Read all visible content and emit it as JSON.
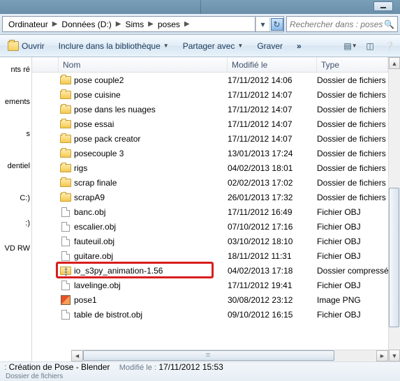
{
  "breadcrumb": {
    "items": [
      "Ordinateur",
      "Données (D:)",
      "Sims",
      "poses"
    ]
  },
  "search": {
    "placeholder": "Rechercher dans : poses"
  },
  "toolbar": {
    "open_label": "Ouvrir",
    "include_label": "Inclure dans la bibliothèque",
    "share_label": "Partager avec",
    "burn_label": "Graver"
  },
  "sidebar": {
    "items": [
      "nts ré",
      "ements",
      "s",
      "dentiel",
      "C:)",
      ":)",
      "VD RW"
    ]
  },
  "columns": {
    "name": "Nom",
    "modified": "Modifié le",
    "type": "Type"
  },
  "files": [
    {
      "icon": "folder",
      "name": "pose couple2",
      "modified": "17/11/2012 14:06",
      "type": "Dossier de fichiers"
    },
    {
      "icon": "folder",
      "name": "pose cuisine",
      "modified": "17/11/2012 14:07",
      "type": "Dossier de fichiers"
    },
    {
      "icon": "folder",
      "name": "pose dans les nuages",
      "modified": "17/11/2012 14:07",
      "type": "Dossier de fichiers"
    },
    {
      "icon": "folder",
      "name": "pose essai",
      "modified": "17/11/2012 14:07",
      "type": "Dossier de fichiers"
    },
    {
      "icon": "folder",
      "name": "pose pack creator",
      "modified": "17/11/2012 14:07",
      "type": "Dossier de fichiers"
    },
    {
      "icon": "folder",
      "name": "posecouple 3",
      "modified": "13/01/2013 17:24",
      "type": "Dossier de fichiers"
    },
    {
      "icon": "folder",
      "name": "rigs",
      "modified": "04/02/2013 18:01",
      "type": "Dossier de fichiers"
    },
    {
      "icon": "folder",
      "name": "scrap finale",
      "modified": "02/02/2013 17:02",
      "type": "Dossier de fichiers"
    },
    {
      "icon": "folder",
      "name": "scrapA9",
      "modified": "26/01/2013 17:32",
      "type": "Dossier de fichiers"
    },
    {
      "icon": "file",
      "name": "banc.obj",
      "modified": "17/11/2012 16:49",
      "type": "Fichier OBJ"
    },
    {
      "icon": "file",
      "name": "escalier.obj",
      "modified": "07/10/2012 17:16",
      "type": "Fichier OBJ"
    },
    {
      "icon": "file",
      "name": "fauteuil.obj",
      "modified": "03/10/2012 18:10",
      "type": "Fichier OBJ"
    },
    {
      "icon": "file",
      "name": "guitare.obj",
      "modified": "18/11/2012 11:31",
      "type": "Fichier OBJ"
    },
    {
      "icon": "zip",
      "name": "io_s3py_animation-1.56",
      "modified": "04/02/2013 17:18",
      "type": "Dossier compressé",
      "highlighted": true
    },
    {
      "icon": "file",
      "name": "lavelinge.obj",
      "modified": "17/11/2012 19:41",
      "type": "Fichier OBJ"
    },
    {
      "icon": "png",
      "name": "pose1",
      "modified": "30/08/2012 23:12",
      "type": "Image PNG"
    },
    {
      "icon": "file",
      "name": "table de bistrot.obj",
      "modified": "09/10/2012 16:15",
      "type": "Fichier OBJ"
    }
  ],
  "details": {
    "title": "Création de Pose - Blender",
    "sub_label": "Modifié le :",
    "sub_value": "17/11/2012 15:53",
    "type_line": "Dossier de fichiers"
  }
}
